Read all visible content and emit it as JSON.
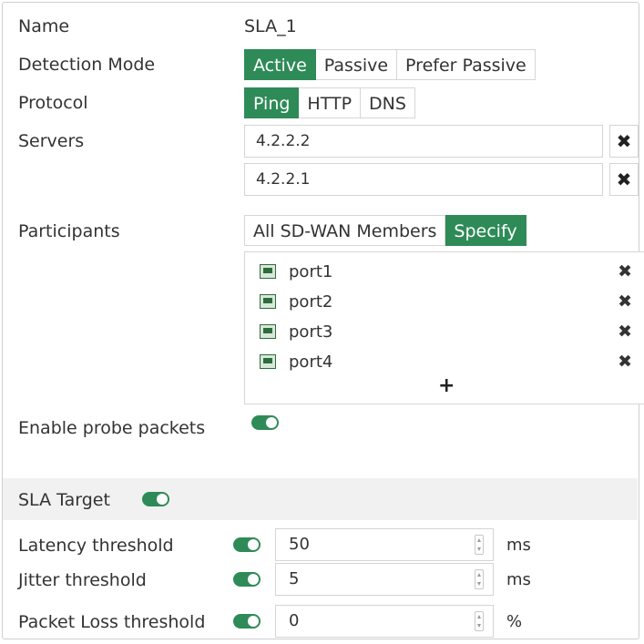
{
  "name": {
    "label": "Name",
    "value": "SLA_1"
  },
  "detection_mode": {
    "label": "Detection Mode",
    "options": [
      "Active",
      "Passive",
      "Prefer Passive"
    ],
    "selected": "Active"
  },
  "protocol": {
    "label": "Protocol",
    "options": [
      "Ping",
      "HTTP",
      "DNS"
    ],
    "selected": "Ping"
  },
  "servers": {
    "label": "Servers",
    "items": [
      "4.2.2.2",
      "4.2.2.1"
    ],
    "remove_icon": "✖"
  },
  "participants": {
    "label": "Participants",
    "options": [
      "All SD-WAN Members",
      "Specify"
    ],
    "selected": "Specify",
    "members": [
      "port1",
      "port2",
      "port3",
      "port4"
    ],
    "remove_icon": "✖",
    "add_icon": "+"
  },
  "probe_packets": {
    "label": "Enable probe packets",
    "enabled": true
  },
  "sla_target": {
    "label": "SLA Target",
    "enabled": true
  },
  "thresholds": [
    {
      "label": "Latency threshold",
      "value": "50",
      "unit": "ms",
      "enabled": true
    },
    {
      "label": "Jitter threshold",
      "value": "5",
      "unit": "ms",
      "enabled": true
    },
    {
      "label": "Packet Loss threshold",
      "value": "0",
      "unit": "%",
      "enabled": true
    }
  ],
  "colors": {
    "accent": "#2e8b57",
    "section_bg": "#f1f1f1",
    "border": "#d4d4d4"
  }
}
